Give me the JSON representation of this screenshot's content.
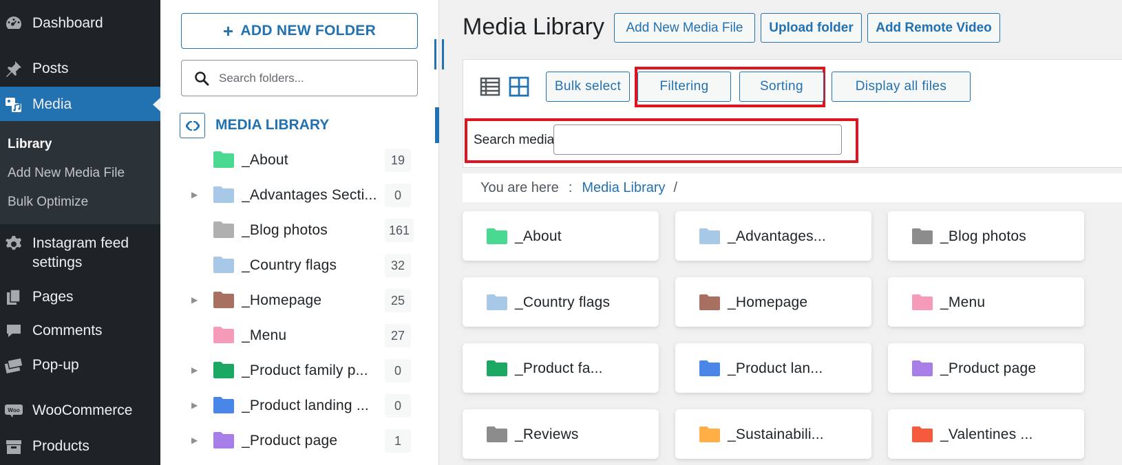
{
  "admin_menu": {
    "items": [
      {
        "label": "Dashboard",
        "icon": "dashboard-icon"
      },
      {
        "label": "Posts",
        "icon": "pin-icon"
      },
      {
        "label": "Media",
        "icon": "media-icon",
        "active": true
      },
      {
        "label": "Instagram feed settings",
        "label_line1": "Instagram feed",
        "label_line2": "settings",
        "icon": "gear-icon"
      },
      {
        "label": "Pages",
        "icon": "pages-icon"
      },
      {
        "label": "Comments",
        "icon": "comment-icon"
      },
      {
        "label": "Pop-up",
        "icon": "popup-icon"
      },
      {
        "label": "WooCommerce",
        "icon": "woocommerce-icon"
      },
      {
        "label": "Products",
        "icon": "products-icon"
      }
    ],
    "submenu": [
      {
        "label": "Library",
        "current": true
      },
      {
        "label": "Add New Media File"
      },
      {
        "label": "Bulk Optimize"
      }
    ]
  },
  "folder_panel": {
    "add_folder_label": "ADD NEW FOLDER",
    "search_placeholder": "Search folders...",
    "root_label": "MEDIA LIBRARY",
    "folders": [
      {
        "name": "_About",
        "count": "19",
        "color": "#4ad991",
        "has_children": false
      },
      {
        "name": "_Advantages Secti...",
        "count": "0",
        "color": "#a8c8e8",
        "has_children": true
      },
      {
        "name": "_Blog photos",
        "count": "161",
        "color": "#b0b0b0",
        "has_children": false
      },
      {
        "name": "_Country flags",
        "count": "32",
        "color": "#a8c8e8",
        "has_children": false
      },
      {
        "name": "_Homepage",
        "count": "25",
        "color": "#a87060",
        "has_children": true
      },
      {
        "name": "_Menu",
        "count": "27",
        "color": "#f59ab8",
        "has_children": false
      },
      {
        "name": "_Product family p...",
        "count": "0",
        "color": "#1aa862",
        "has_children": true
      },
      {
        "name": "_Product landing ...",
        "count": "0",
        "color": "#4a86e8",
        "has_children": true
      },
      {
        "name": "_Product page",
        "count": "1",
        "color": "#a77ee8",
        "has_children": true
      }
    ]
  },
  "main": {
    "title": "Media Library",
    "header_buttons": {
      "add_new": "Add New Media File",
      "upload_folder": "Upload folder",
      "add_remote_video": "Add Remote Video"
    },
    "toolbar": {
      "list_view_icon": "list-view-icon",
      "grid_view_icon": "grid-view-icon",
      "bulk_select": "Bulk select",
      "filtering": "Filtering",
      "sorting": "Sorting",
      "display_all": "Display all files",
      "search_label": "Search media",
      "search_value": ""
    },
    "breadcrumb": {
      "prefix": "You are here",
      "separator": ":",
      "link": "Media Library",
      "slash": "/"
    },
    "cards": [
      {
        "name": "_About",
        "color": "#4ad991"
      },
      {
        "name": "_Advantages...",
        "color": "#a8c8e8"
      },
      {
        "name": "_Blog photos",
        "color": "#8c8c8c"
      },
      {
        "name": "_Country flags",
        "color": "#a8c8e8"
      },
      {
        "name": "_Homepage",
        "color": "#a87060"
      },
      {
        "name": "_Menu",
        "color": "#f59ab8"
      },
      {
        "name": "_Product fa...",
        "color": "#1aa862"
      },
      {
        "name": "_Product lan...",
        "color": "#4a86e8"
      },
      {
        "name": "_Product page",
        "color": "#a77ee8"
      },
      {
        "name": "_Reviews",
        "color": "#8c8c8c"
      },
      {
        "name": "_Sustainabili...",
        "color": "#ffad45"
      },
      {
        "name": "_Valentines ...",
        "color": "#f55a3c"
      }
    ],
    "highlight_color": "#e0141e",
    "accent_color": "#2271b1"
  }
}
